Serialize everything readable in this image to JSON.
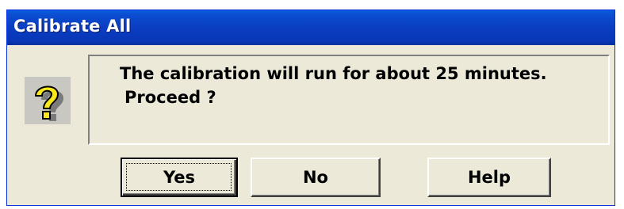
{
  "window": {
    "title": "Calibrate All"
  },
  "icon": {
    "name": "question-icon",
    "glyph": "?",
    "color": "#f8e81c"
  },
  "message": {
    "line1": "The calibration will run for about 25 minutes.",
    "line2": "Proceed ?"
  },
  "buttons": {
    "yes": "Yes",
    "no": "No",
    "help": "Help"
  },
  "colors": {
    "titlebar": "#0a3dc2",
    "dialog_bg": "#ece9d8"
  }
}
